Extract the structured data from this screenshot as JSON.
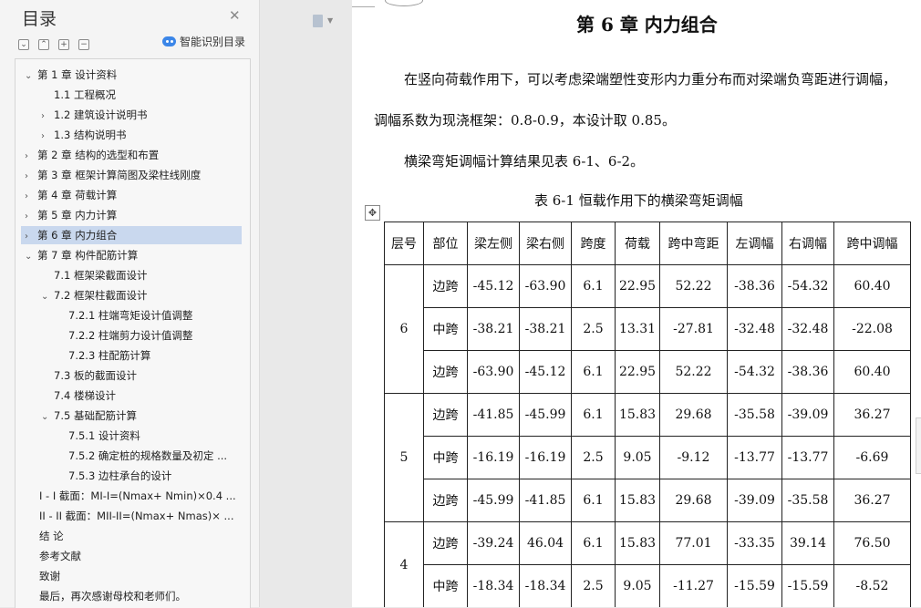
{
  "sidebar": {
    "title": "目录",
    "smart_toc_label": "智能识别目录",
    "toc": [
      {
        "label": "第 1 章  设计资料",
        "arrow": "⌄",
        "level": 1
      },
      {
        "label": "1.1  工程概况",
        "arrow": "",
        "level": 2
      },
      {
        "label": "1.2  建筑设计说明书",
        "arrow": "›",
        "level": 2
      },
      {
        "label": "1.3  结构说明书",
        "arrow": "›",
        "level": 2
      },
      {
        "label": "第 2 章  结构的选型和布置",
        "arrow": "›",
        "level": 1
      },
      {
        "label": "第 3 章  框架计算简图及梁柱线刚度",
        "arrow": "›",
        "level": 1
      },
      {
        "label": "第 4 章  荷载计算",
        "arrow": "›",
        "level": 1
      },
      {
        "label": "第 5 章  内力计算",
        "arrow": "›",
        "level": 1
      },
      {
        "label": "第 6 章  内力组合",
        "arrow": "›",
        "level": 1,
        "selected": true
      },
      {
        "label": "第 7 章  构件配筋计算",
        "arrow": "⌄",
        "level": 1
      },
      {
        "label": "7.1  框架梁截面设计",
        "arrow": "",
        "level": 2
      },
      {
        "label": "7.2  框架柱截面设计",
        "arrow": "⌄",
        "level": 2
      },
      {
        "label": "7.2.1  柱端弯矩设计值调整",
        "arrow": "",
        "level": 3
      },
      {
        "label": "7.2.2  柱端剪力设计值调整",
        "arrow": "",
        "level": 3
      },
      {
        "label": "7.2.3  柱配筋计算",
        "arrow": "",
        "level": 3
      },
      {
        "label": "7.3  板的截面设计",
        "arrow": "",
        "level": 2
      },
      {
        "label": "7.4  楼梯设计",
        "arrow": "",
        "level": 2
      },
      {
        "label": "7.5  基础配筋计算",
        "arrow": "⌄",
        "level": 2
      },
      {
        "label": "7.5.1  设计资料",
        "arrow": "",
        "level": 3
      },
      {
        "label": "7.5.2  确定桩的规格数量及初定 ...",
        "arrow": "",
        "level": 3
      },
      {
        "label": "7.5.3  边柱承台的设计",
        "arrow": "",
        "level": 3
      },
      {
        "label": "I - I 截面：MI-I=(Nmax+ Nmin)×0.4 ...",
        "arrow": "",
        "level": 0
      },
      {
        "label": "II - II 截面：MII-II=(Nmax+ Nmas)× ...",
        "arrow": "",
        "level": 0
      },
      {
        "label": "结    论",
        "arrow": "",
        "level": 0
      },
      {
        "label": "参考文献",
        "arrow": "",
        "level": 0
      },
      {
        "label": "致谢",
        "arrow": "",
        "level": 0
      },
      {
        "label": "最后，再次感谢母校和老师们。",
        "arrow": "",
        "level": 0
      }
    ]
  },
  "document": {
    "chapter_title": "第 6 章  内力组合",
    "para1": "在竖向荷载作用下，可以考虑梁端塑性变形内力重分布而对梁端负弯距进行调幅，",
    "para2": "调幅系数为现浇框架：0.8-0.9，本设计取 0.85。",
    "para3": "横梁弯矩调幅计算结果见表 6-1、6-2。",
    "table_caption": "表 6-1    恒载作用下的横梁弯矩调幅",
    "table": {
      "headers": [
        "层号",
        "部位",
        "梁左侧",
        "梁右侧",
        "跨度",
        "荷载",
        "跨中弯距",
        "左调幅",
        "右调幅",
        "跨中调幅"
      ],
      "groups": [
        {
          "floor": "6",
          "rows": [
            [
              "边跨",
              "-45.12",
              "-63.90",
              "6.1",
              "22.95",
              "52.22",
              "-38.36",
              "-54.32",
              "60.40"
            ],
            [
              "中跨",
              "-38.21",
              "-38.21",
              "2.5",
              "13.31",
              "-27.81",
              "-32.48",
              "-32.48",
              "-22.08"
            ],
            [
              "边跨",
              "-63.90",
              "-45.12",
              "6.1",
              "22.95",
              "52.22",
              "-54.32",
              "-38.36",
              "60.40"
            ]
          ]
        },
        {
          "floor": "5",
          "rows": [
            [
              "边跨",
              "-41.85",
              "-45.99",
              "6.1",
              "15.83",
              "29.68",
              "-35.58",
              "-39.09",
              "36.27"
            ],
            [
              "中跨",
              "-16.19",
              "-16.19",
              "2.5",
              "9.05",
              "-9.12",
              "-13.77",
              "-13.77",
              "-6.69"
            ],
            [
              "边跨",
              "-45.99",
              "-41.85",
              "6.1",
              "15.83",
              "29.68",
              "-39.09",
              "-35.58",
              "36.27"
            ]
          ]
        },
        {
          "floor": "4",
          "rows": [
            [
              "边跨",
              "-39.24",
              "46.04",
              "6.1",
              "15.83",
              "77.01",
              "-33.35",
              "39.14",
              "76.50"
            ],
            [
              "中跨",
              "-18.34",
              "-18.34",
              "2.5",
              "9.05",
              "-11.27",
              "-15.59",
              "-15.59",
              "-8.52"
            ]
          ]
        }
      ]
    }
  }
}
